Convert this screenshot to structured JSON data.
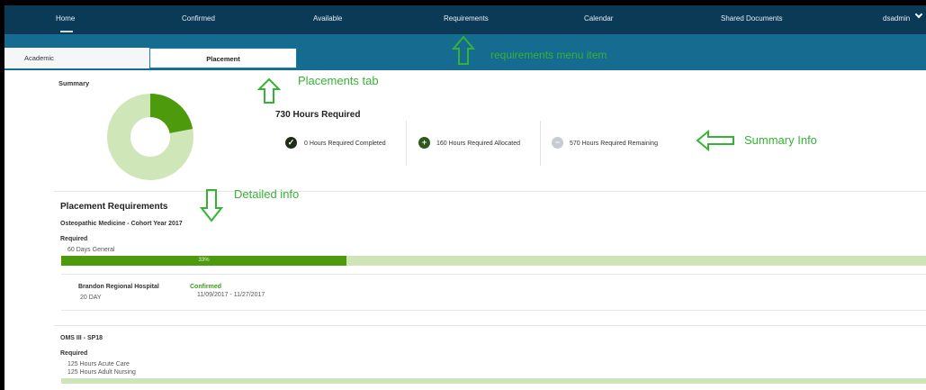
{
  "nav": {
    "home": "Home",
    "confirmed": "Confirmed",
    "available": "Available",
    "requirements": "Requirements",
    "calendar": "Calendar",
    "shared_documents": "Shared Documents",
    "user": "dsadmin"
  },
  "tabs": {
    "academic": "Academic",
    "placement": "Placement"
  },
  "annotations": {
    "requirements_menu_item": "requirements menu item",
    "placements_tab": "Placements tab",
    "summary_info": "Summary Info",
    "detailed_info": "Detailed info"
  },
  "summary": {
    "title": "Summary",
    "hours_required": "730 Hours Required",
    "completed": "0 Hours Required Completed",
    "allocated": "160 Hours Required Allocated",
    "remaining": "570 Hours Required Remaining",
    "donut": {
      "allocated_fraction": 0.22
    }
  },
  "placement_requirements": {
    "title": "Placement Requirements",
    "groups": [
      {
        "name": "Osteopathic Medicine - Cohort Year 2017",
        "required_label": "Required",
        "items": [
          "60 Days General"
        ],
        "progress": {
          "percent": 33,
          "label": "33%"
        },
        "placements": [
          {
            "site": "Brandon Regional Hospital",
            "duration": "20 DAY",
            "status": "Confirmed",
            "dates": "11/09/2017 - 11/27/2017"
          }
        ]
      },
      {
        "name": "OMS III - SP18",
        "required_label": "Required",
        "items": [
          "125 Hours Acute Care",
          "125 Hours Adult Nursing"
        ]
      }
    ]
  },
  "colors": {
    "nav_bg": "#0b3a57",
    "subbar_bg": "#166b90",
    "progress_fill": "#4d9a0c",
    "progress_bg": "#cde5b7",
    "annotation": "#36b336",
    "confirmed": "#3c9a1a"
  },
  "icons": {
    "completed": "check-circle-icon",
    "allocated": "plus-circle-icon",
    "remaining": "minus-circle-icon"
  }
}
